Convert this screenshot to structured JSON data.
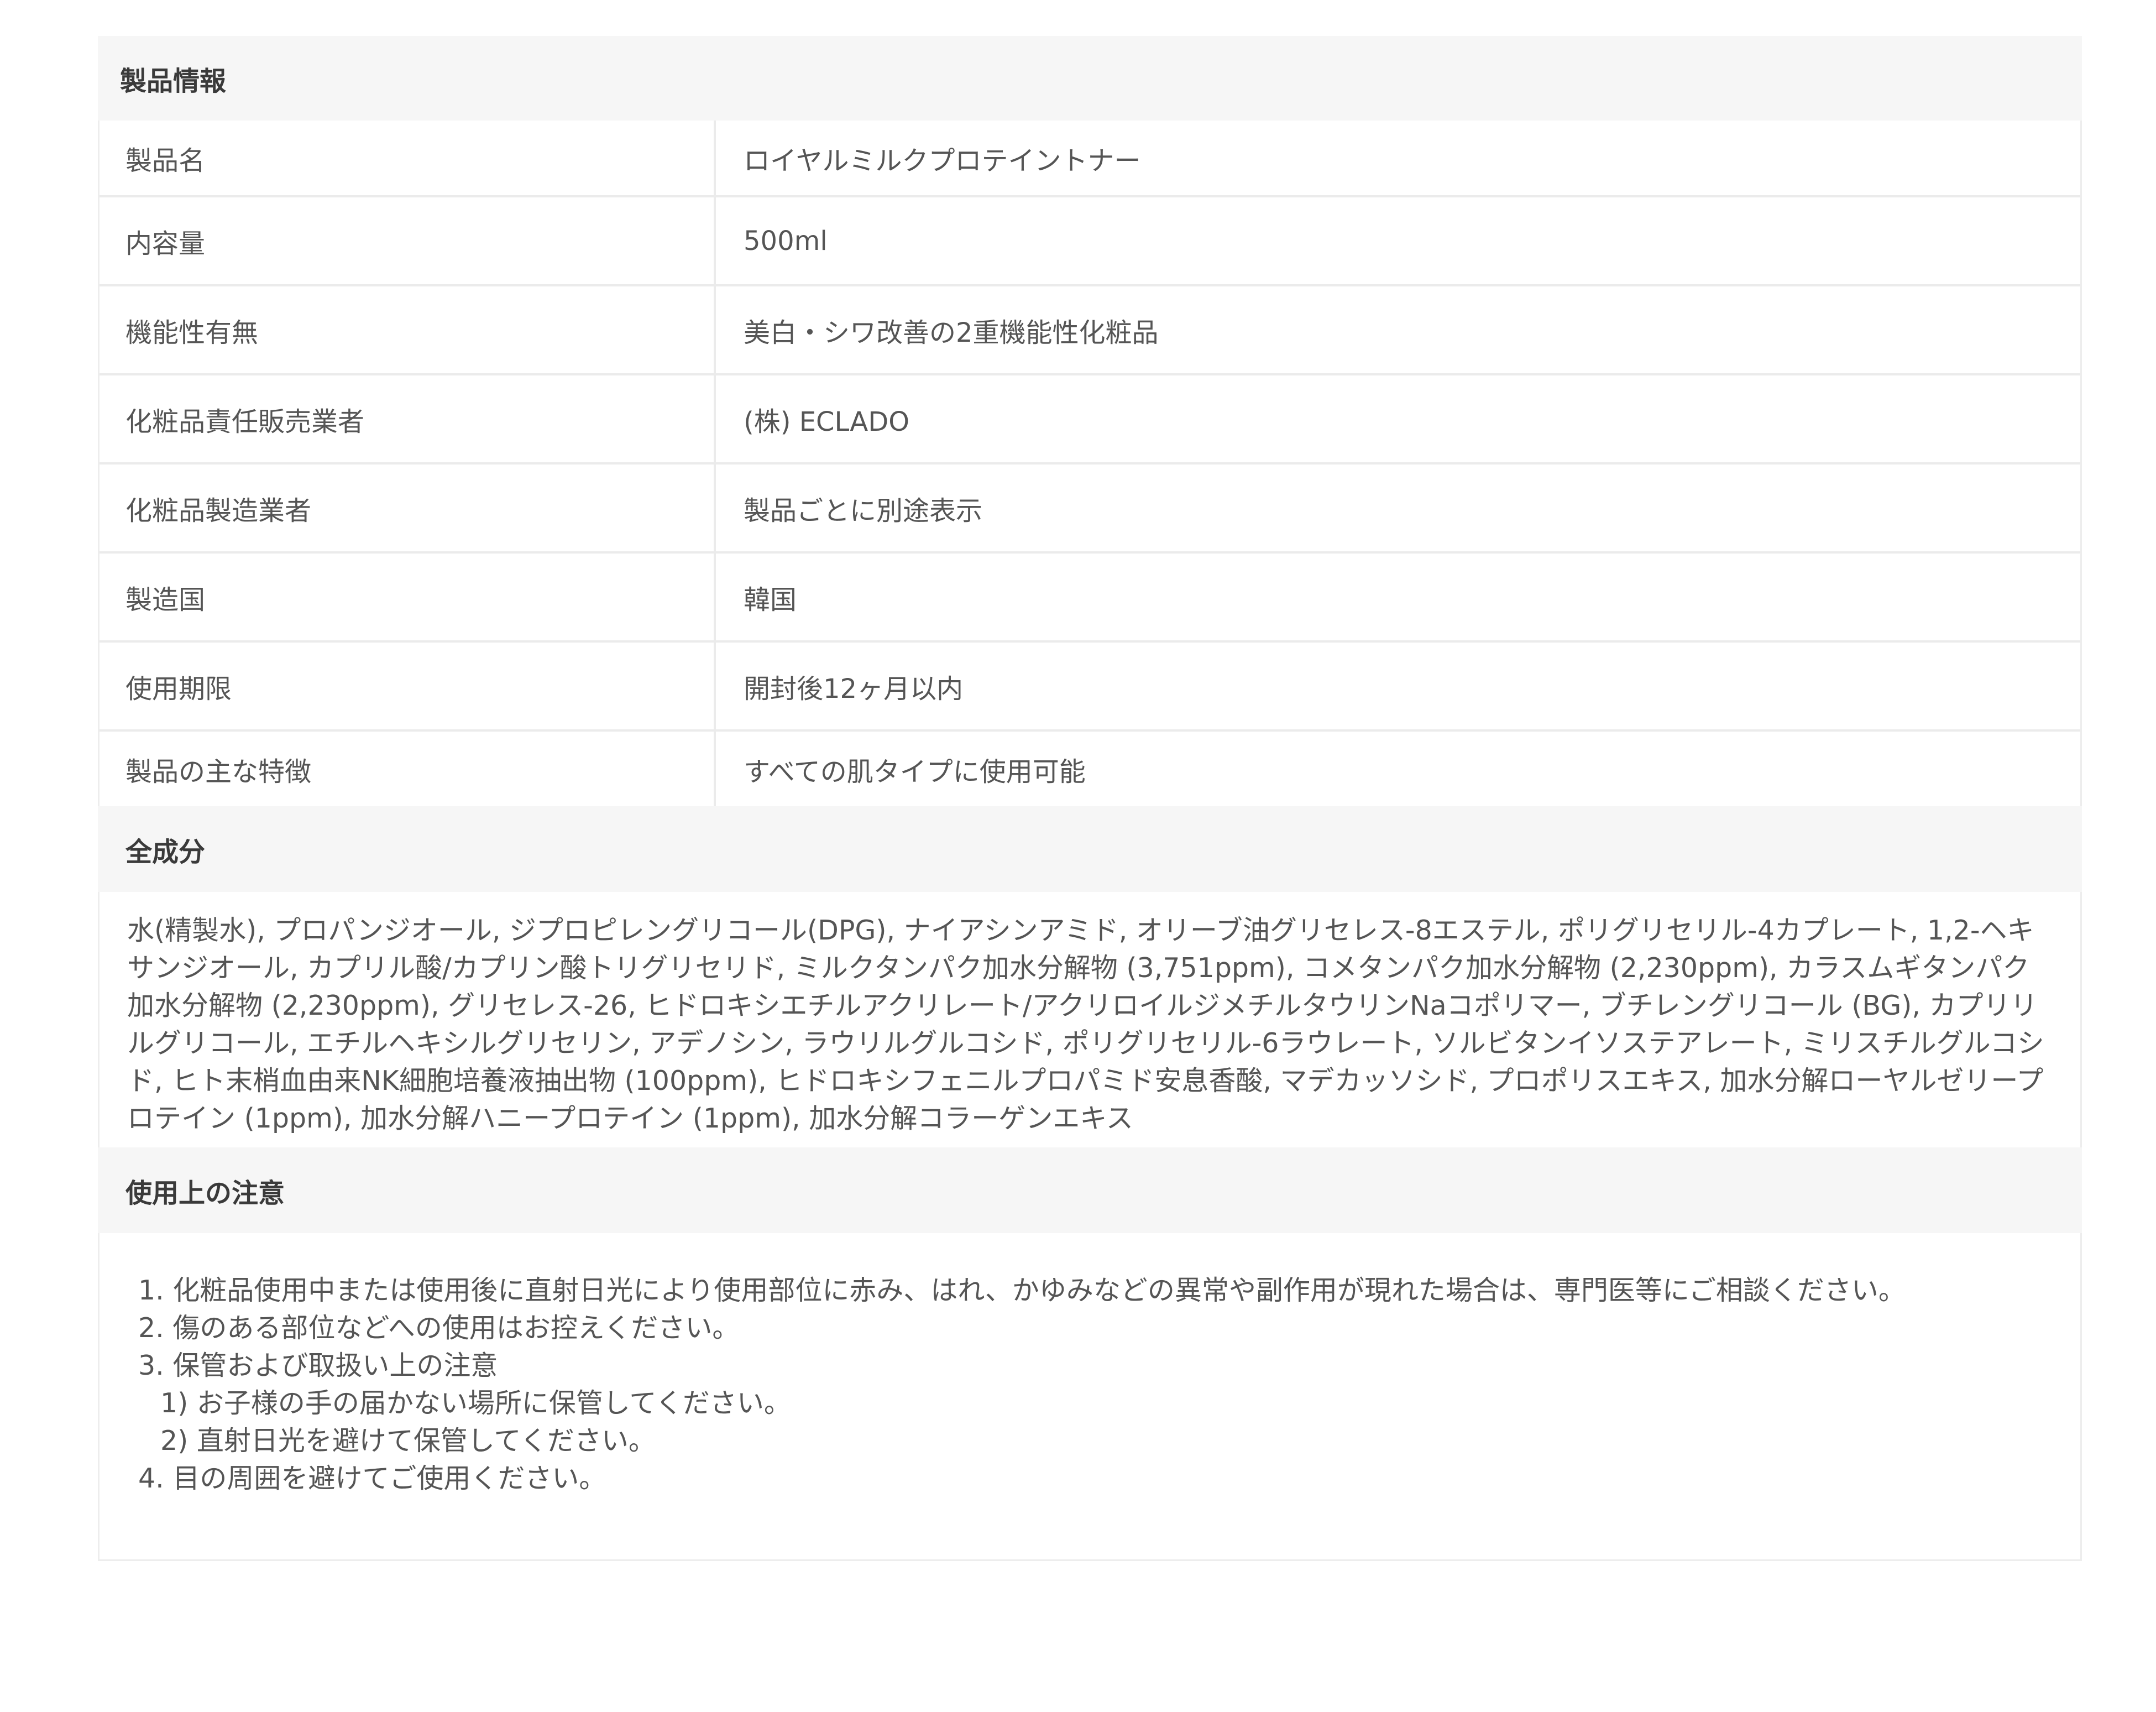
{
  "product_info": {
    "heading": "製品情報",
    "rows": [
      {
        "label": "製品名",
        "value": "ロイヤルミルクプロテイントナー"
      },
      {
        "label": "内容量",
        "value": "500ml"
      },
      {
        "label": "機能性有無",
        "value": "美白・シワ改善の2重機能性化粧品"
      },
      {
        "label": "化粧品責任販売業者",
        "value": "(株) ECLADO"
      },
      {
        "label": "化粧品製造業者",
        "value": "製品ごとに別途表示"
      },
      {
        "label": "製造国",
        "value": "韓国"
      },
      {
        "label": "使用期限",
        "value": "開封後12ヶ月以内"
      },
      {
        "label": "製品の主な特徴",
        "value": "すべての肌タイプに使用可能"
      }
    ]
  },
  "ingredients": {
    "heading": "全成分",
    "text": "水(精製水), プロパンジオール, ジプロピレングリコール(DPG), ナイアシンアミド, オリーブ油グリセレス-8エステル, ポリグリセリル-4カプレート, 1,2-ヘキサンジオール, カプリル酸/カプリン酸トリグリセリド, ミルクタンパク加水分解物 (3,751ppm), コメタンパク加水分解物 (2,230ppm), カラスムギタンパク加水分解物 (2,230ppm), グリセレス-26, ヒドロキシエチルアクリレート/アクリロイルジメチルタウリンNaコポリマー, ブチレングリコール (BG), カプリリルグリコール, エチルヘキシルグリセリン, アデノシン, ラウリルグルコシド, ポリグリセリル-6ラウレート, ソルビタンイソステアレート, ミリスチルグルコシド, ヒト末梢血由来NK細胞培養液抽出物 (100ppm), ヒドロキシフェニルプロパミド安息香酸, マデカッソシド, プロポリスエキス, 加水分解ローヤルゼリープロテイン (1ppm), 加水分解ハニープロテイン (1ppm), 加水分解コラーゲンエキス"
  },
  "caution": {
    "heading": "使用上の注意",
    "items": [
      "1. 化粧品使用中または使用後に直射日光により使用部位に赤み、はれ、かゆみなどの異常や副作用が現れた場合は、専門医等にご相談ください。",
      "2. 傷のある部位などへの使用はお控えください。",
      "3. 保管および取扱い上の注意",
      "1) お子様の手の届かない場所に保管してください。",
      "2) 直射日光を避けて保管してください。",
      "4. 目の周囲を避けてご使用ください。"
    ]
  }
}
